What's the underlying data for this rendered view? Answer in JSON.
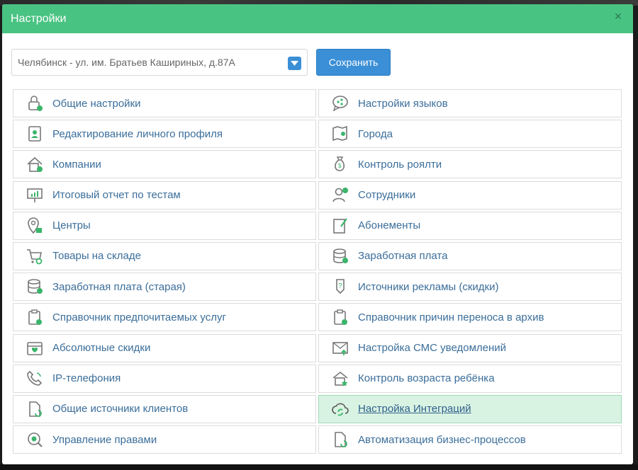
{
  "dialog": {
    "title": "Настройки",
    "close_glyph": "×"
  },
  "toolbar": {
    "location_value": "Челябинск - ул. им. Братьев Кашириных, д.87А",
    "save_label": "Сохранить"
  },
  "colors": {
    "header": "#49c382",
    "button": "#3b8fd6",
    "link": "#3b6e9a",
    "active_row": "#d9f3e3"
  },
  "menu": {
    "left": [
      {
        "label": "Общие настройки",
        "icon": "lock-settings-icon"
      },
      {
        "label": "Редактирование личного профиля",
        "icon": "profile-card-icon"
      },
      {
        "label": "Компании",
        "icon": "building-icon"
      },
      {
        "label": "Итоговый отчет по тестам",
        "icon": "presentation-chart-icon"
      },
      {
        "label": "Центры",
        "icon": "location-pin-icon"
      },
      {
        "label": "Товары на складе",
        "icon": "cart-search-icon"
      },
      {
        "label": "Заработная плата (старая)",
        "icon": "coins-stack-icon"
      },
      {
        "label": "Справочник предпочитаемых услуг",
        "icon": "clipboard-check-icon"
      },
      {
        "label": "Абсолютные скидки",
        "icon": "calendar-heart-icon"
      },
      {
        "label": "IP-телефония",
        "icon": "phone-icon"
      },
      {
        "label": "Общие источники клиентов",
        "icon": "document-refresh-icon"
      },
      {
        "label": "Управление правами",
        "icon": "eye-target-icon"
      }
    ],
    "right": [
      {
        "label": "Настройки языков",
        "icon": "chat-share-icon"
      },
      {
        "label": "Города",
        "icon": "map-pin-icon"
      },
      {
        "label": "Контроль роялти",
        "icon": "money-bag-icon"
      },
      {
        "label": "Сотрудники",
        "icon": "user-add-icon"
      },
      {
        "label": "Абонементы",
        "icon": "document-edit-icon"
      },
      {
        "label": "Заработная плата",
        "icon": "coins-stack-icon"
      },
      {
        "label": "Источники рекламы (скидки)",
        "icon": "question-tag-icon"
      },
      {
        "label": "Справочник причин переноса в архив",
        "icon": "clipboard-check-icon"
      },
      {
        "label": "Настройка СМС уведомлений",
        "icon": "envelope-icon"
      },
      {
        "label": "Контроль возраста ребёнка",
        "icon": "house-star-icon"
      },
      {
        "label": "Настройка Интеграций",
        "icon": "cloud-sync-icon",
        "active": true
      },
      {
        "label": "Автоматизация бизнес-процессов",
        "icon": "document-refresh-icon"
      }
    ]
  }
}
